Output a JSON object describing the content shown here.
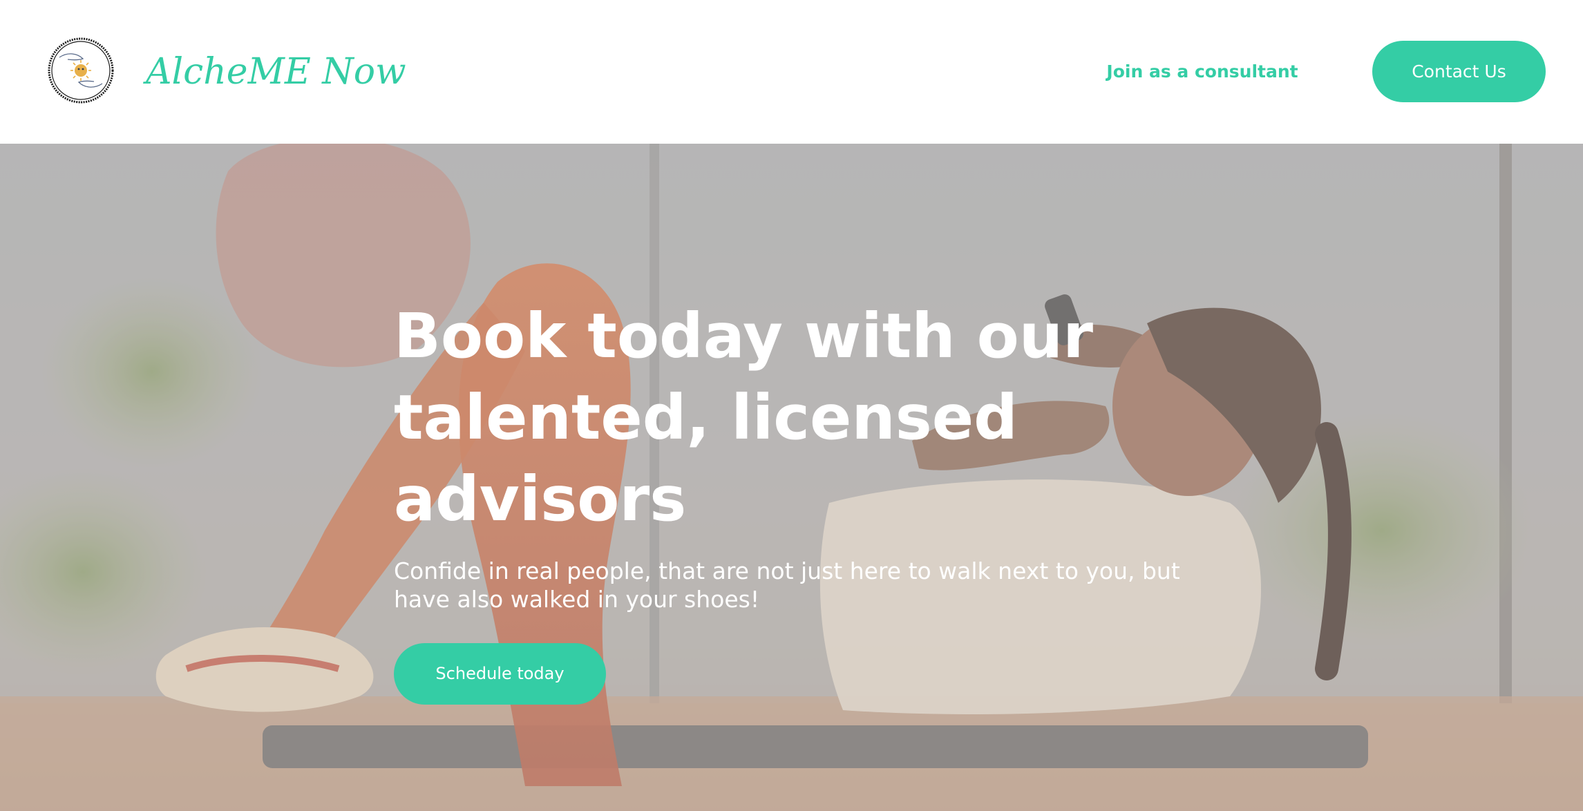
{
  "header": {
    "brand": "AlcheME Now",
    "logo_icon": "hands-sun-logo-icon",
    "join_link": "Join as a consultant",
    "contact_button": "Contact Us"
  },
  "hero": {
    "title": "Book today with our talented, licensed advisors",
    "subtitle": "Confide in real people, that are not just here to walk next to you, but have also walked in your shoes!",
    "cta_button": "Schedule today",
    "background_image": "woman-doing-crunches-photo"
  },
  "colors": {
    "accent": "#34cda5",
    "header_bg": "#ffffff",
    "hero_text": "#ffffff"
  }
}
